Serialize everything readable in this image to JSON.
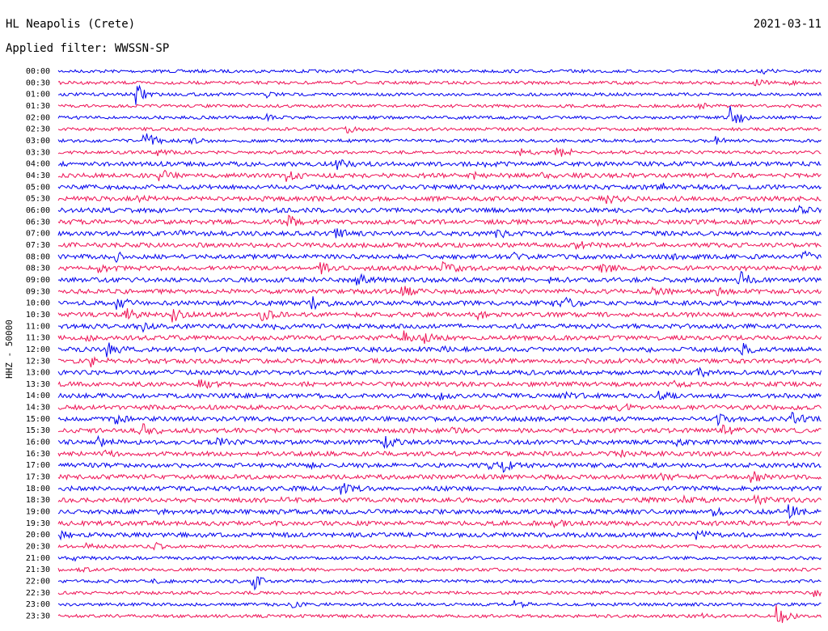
{
  "header": {
    "station": "HL Neapolis (Crete)",
    "date": "2021-03-11",
    "filter_label": "Applied filter: WWSSN-SP"
  },
  "chart_data": {
    "type": "line",
    "title": "HL Neapolis (Crete)",
    "ylabel": "HHZ - 50000",
    "xlabel": "",
    "row_labels": [
      "00:00",
      "00:30",
      "01:00",
      "01:30",
      "02:00",
      "02:30",
      "03:00",
      "03:30",
      "04:00",
      "04:30",
      "05:00",
      "05:30",
      "06:00",
      "06:30",
      "07:00",
      "07:30",
      "08:00",
      "08:30",
      "09:00",
      "09:30",
      "10:00",
      "10:30",
      "11:00",
      "11:30",
      "12:00",
      "12:30",
      "13:00",
      "13:30",
      "14:00",
      "14:30",
      "15:00",
      "15:30",
      "16:00",
      "16:30",
      "17:00",
      "17:30",
      "18:00",
      "18:30",
      "19:00",
      "19:30",
      "20:00",
      "20:30",
      "21:00",
      "21:30",
      "22:00",
      "22:30",
      "23:00",
      "23:30"
    ],
    "row_colors": [
      "#0000ee",
      "#ee1155"
    ],
    "grid": false,
    "legend": "none",
    "notable_events": [
      {
        "row": "01:00",
        "x_frac": 0.1
      },
      {
        "row": "02:00",
        "x_frac": 0.88
      },
      {
        "row": "03:00",
        "x_frac": 0.11
      },
      {
        "row": "03:30",
        "x_frac": 0.65
      },
      {
        "row": "22:00",
        "x_frac": 0.25
      },
      {
        "row": "23:30",
        "x_frac": 0.94
      }
    ]
  }
}
